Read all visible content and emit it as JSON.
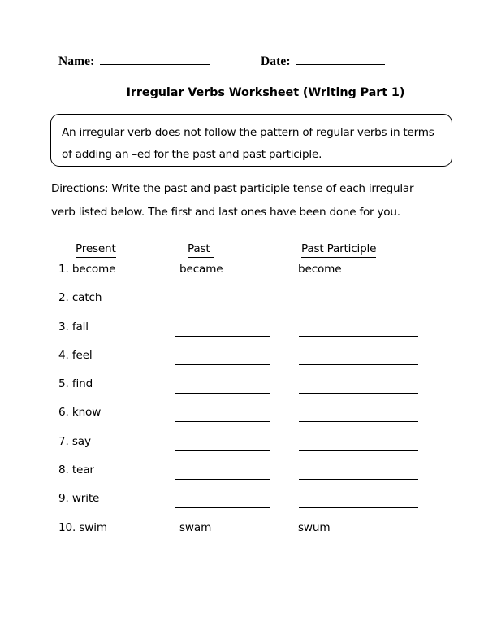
{
  "header": {
    "name_label": "Name:",
    "name_value": "",
    "date_label": "Date:",
    "date_value": ""
  },
  "title": "Irregular Verbs Worksheet (Writing Part 1)",
  "definition": "An irregular verb does not follow the pattern of regular verbs in terms of adding an –ed for the past and past participle.",
  "directions": "Directions: Write the past and past participle tense of each irregular verb listed below. The first and last ones have been done for you.",
  "columns": {
    "present": "Present",
    "past": "Past ",
    "past_participle": "Past Participle"
  },
  "rows": [
    {
      "number": "1.",
      "present": "1. become",
      "past": "became",
      "past_participle": "become",
      "filled": true
    },
    {
      "number": "2.",
      "present": "2. catch",
      "past": "",
      "past_participle": "",
      "filled": false
    },
    {
      "number": "3.",
      "present": "3. fall",
      "past": "",
      "past_participle": "",
      "filled": false
    },
    {
      "number": "4.",
      "present": "4. feel",
      "past": "",
      "past_participle": "",
      "filled": false
    },
    {
      "number": "5.",
      "present": "5. find",
      "past": "",
      "past_participle": "",
      "filled": false
    },
    {
      "number": "6.",
      "present": "6. know",
      "past": "",
      "past_participle": "",
      "filled": false
    },
    {
      "number": "7.",
      "present": "7. say",
      "past": "",
      "past_participle": "",
      "filled": false
    },
    {
      "number": "8.",
      "present": "8. tear",
      "past": "",
      "past_participle": "",
      "filled": false
    },
    {
      "number": "9.",
      "present": "9. write",
      "past": "",
      "past_participle": "",
      "filled": false
    },
    {
      "number": "10.",
      "present": "10. swim",
      "past": "swam",
      "past_participle": "swum",
      "filled": true
    }
  ],
  "colors": {
    "ink": "#000000",
    "page": "#ffffff"
  }
}
